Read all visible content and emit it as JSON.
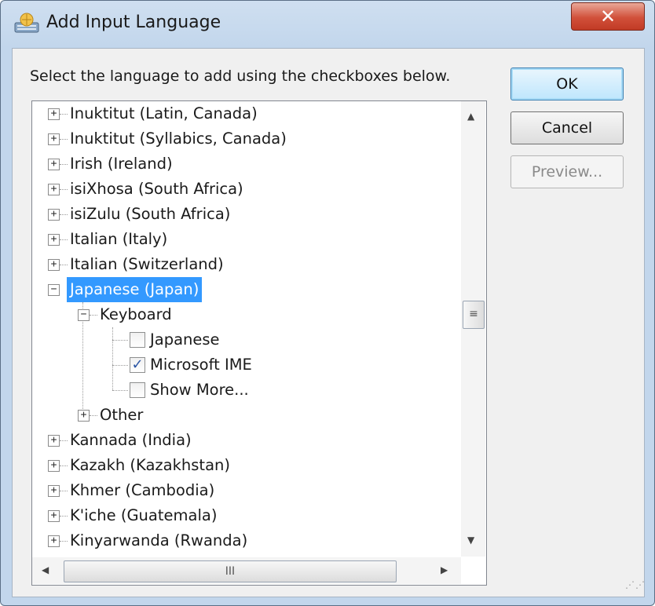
{
  "window": {
    "title": "Add Input Language",
    "close_glyph": "✕"
  },
  "instructions": "Select the language to add using the checkboxes below.",
  "buttons": {
    "ok": "OK",
    "cancel": "Cancel",
    "preview": "Preview..."
  },
  "tree": {
    "languages_top": [
      "Inuktitut (Latin, Canada)",
      "Inuktitut (Syllabics, Canada)",
      "Irish (Ireland)",
      "isiXhosa (South Africa)",
      "isiZulu (South Africa)",
      "Italian (Italy)",
      "Italian (Switzerland)"
    ],
    "selected_language": "Japanese (Japan)",
    "keyboard_label": "Keyboard",
    "keyboard_items": [
      {
        "label": "Japanese",
        "checked": false
      },
      {
        "label": "Microsoft IME",
        "checked": true
      },
      {
        "label": "Show More...",
        "checked": false
      }
    ],
    "other_label": "Other",
    "languages_bottom": [
      "Kannada (India)",
      "Kazakh (Kazakhstan)",
      "Khmer (Cambodia)",
      "K'iche (Guatemala)",
      "Kinyarwanda (Rwanda)"
    ],
    "expand_glyph": "+",
    "collapse_glyph": "−",
    "check_glyph": "✓"
  },
  "scrollbars": {
    "up_glyph": "▲",
    "down_glyph": "▼",
    "left_glyph": "◀",
    "right_glyph": "▶",
    "v_thumb_glyph": "≡",
    "h_thumb_glyph": "III"
  },
  "icons": {
    "app": "keyboard-language-icon",
    "close": "close-icon"
  },
  "colors": {
    "selection": "#3399ff",
    "close_button": "#c13a25",
    "checkmark": "#2a55a4"
  }
}
